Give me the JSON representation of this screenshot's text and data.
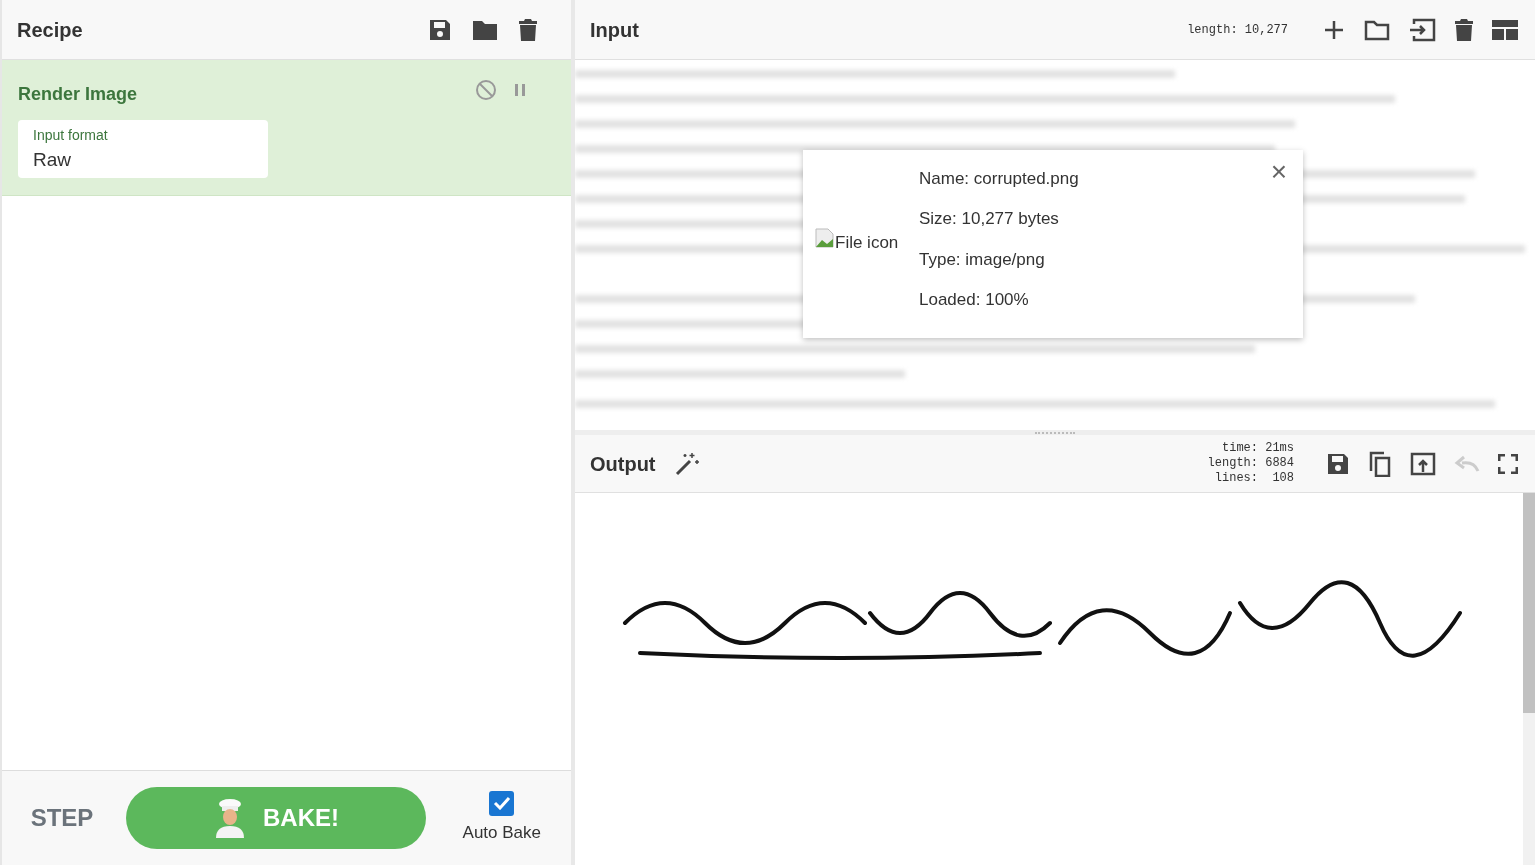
{
  "recipe": {
    "title": "Recipe",
    "operations": [
      {
        "name": "Render Image",
        "args": [
          {
            "label": "Input format",
            "value": "Raw"
          }
        ]
      }
    ]
  },
  "input": {
    "title": "Input",
    "length": "length: 10,277",
    "file_info": {
      "icon_alt": "File icon",
      "lines": [
        "Name: corrupted.png",
        "Size: 10,277 bytes",
        "Type: image/png",
        "Loaded: 100%"
      ],
      "close": "×"
    }
  },
  "output": {
    "title": "Output",
    "stats": [
      "time: 21ms",
      "length: 6884",
      "lines:  108"
    ],
    "content": {
      "kind": "picture"
    }
  },
  "controls": {
    "step": "STEP",
    "bake": "BAKE!",
    "auto_bake": {
      "label": "Auto Bake",
      "checked": true
    }
  }
}
